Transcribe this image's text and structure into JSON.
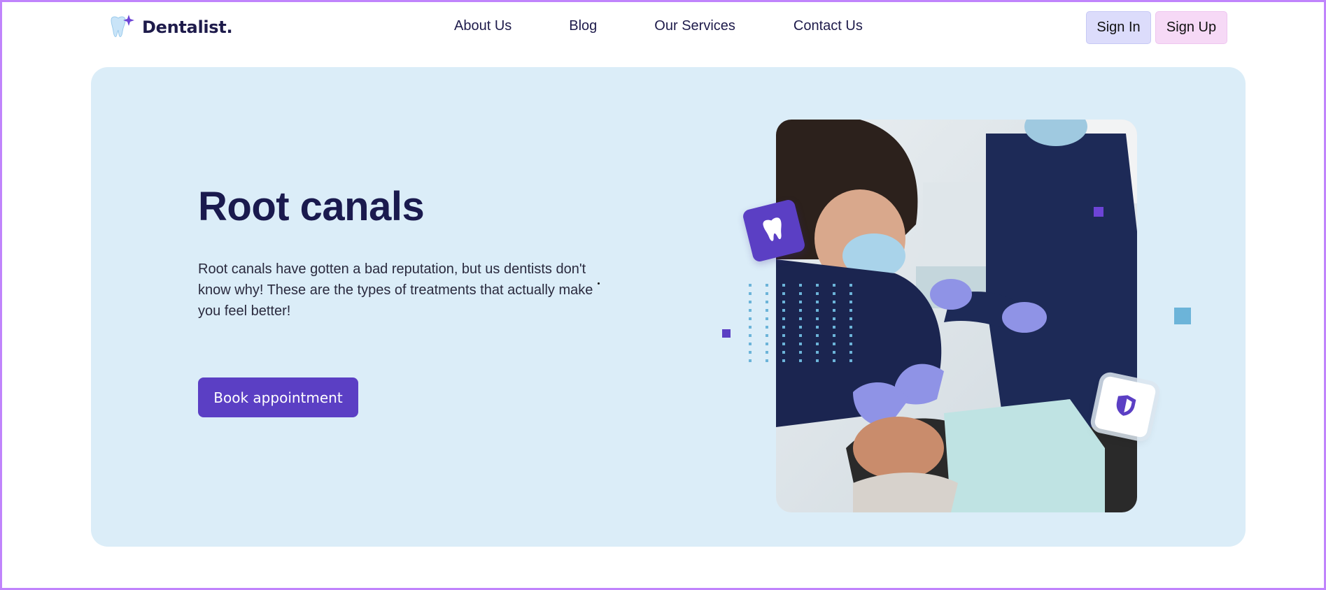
{
  "brand": {
    "name": "Dentalist.",
    "logo_icon": "tooth-sparkle-icon",
    "accent": "#5b3fc4"
  },
  "nav": {
    "items": [
      {
        "label": "About Us"
      },
      {
        "label": "Blog"
      },
      {
        "label": "Our Services"
      },
      {
        "label": "Contact Us"
      }
    ]
  },
  "auth": {
    "sign_in": "Sign In",
    "sign_up": "Sign Up"
  },
  "hero": {
    "title": "Root canals",
    "description": "Root canals have gotten a bad reputation, but us dentists don't know why! These are the types of treatments that actually make you feel better!",
    "cta_label": "Book appointment",
    "background": "#dbedf8",
    "image_icon": "dental-procedure-photo",
    "badge_icons": [
      "tooth-icon",
      "shield-icon"
    ]
  }
}
